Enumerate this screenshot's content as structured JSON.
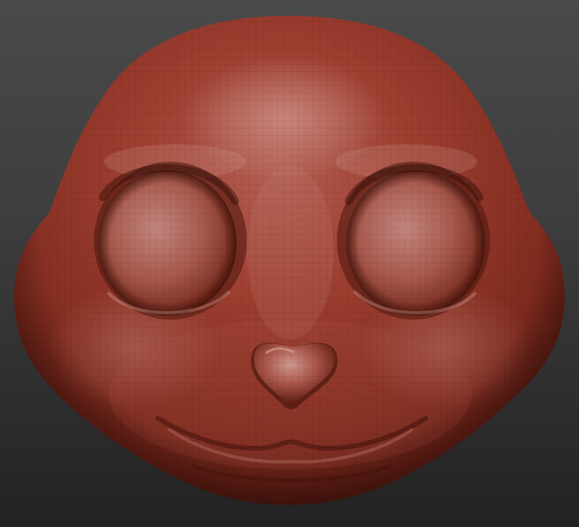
{
  "viewport": {
    "background_top": "#4a4a4a",
    "background_bottom": "#222222"
  },
  "model": {
    "subject": "sculpted-creature-head",
    "material_base_color": "#9e3c2e",
    "material_highlight_color": "#c98a82",
    "material_shadow_color": "#3e120c",
    "wireframe_visible": true,
    "features": [
      "head",
      "left-eye-socket",
      "right-eye-socket",
      "nose",
      "mouth"
    ]
  }
}
